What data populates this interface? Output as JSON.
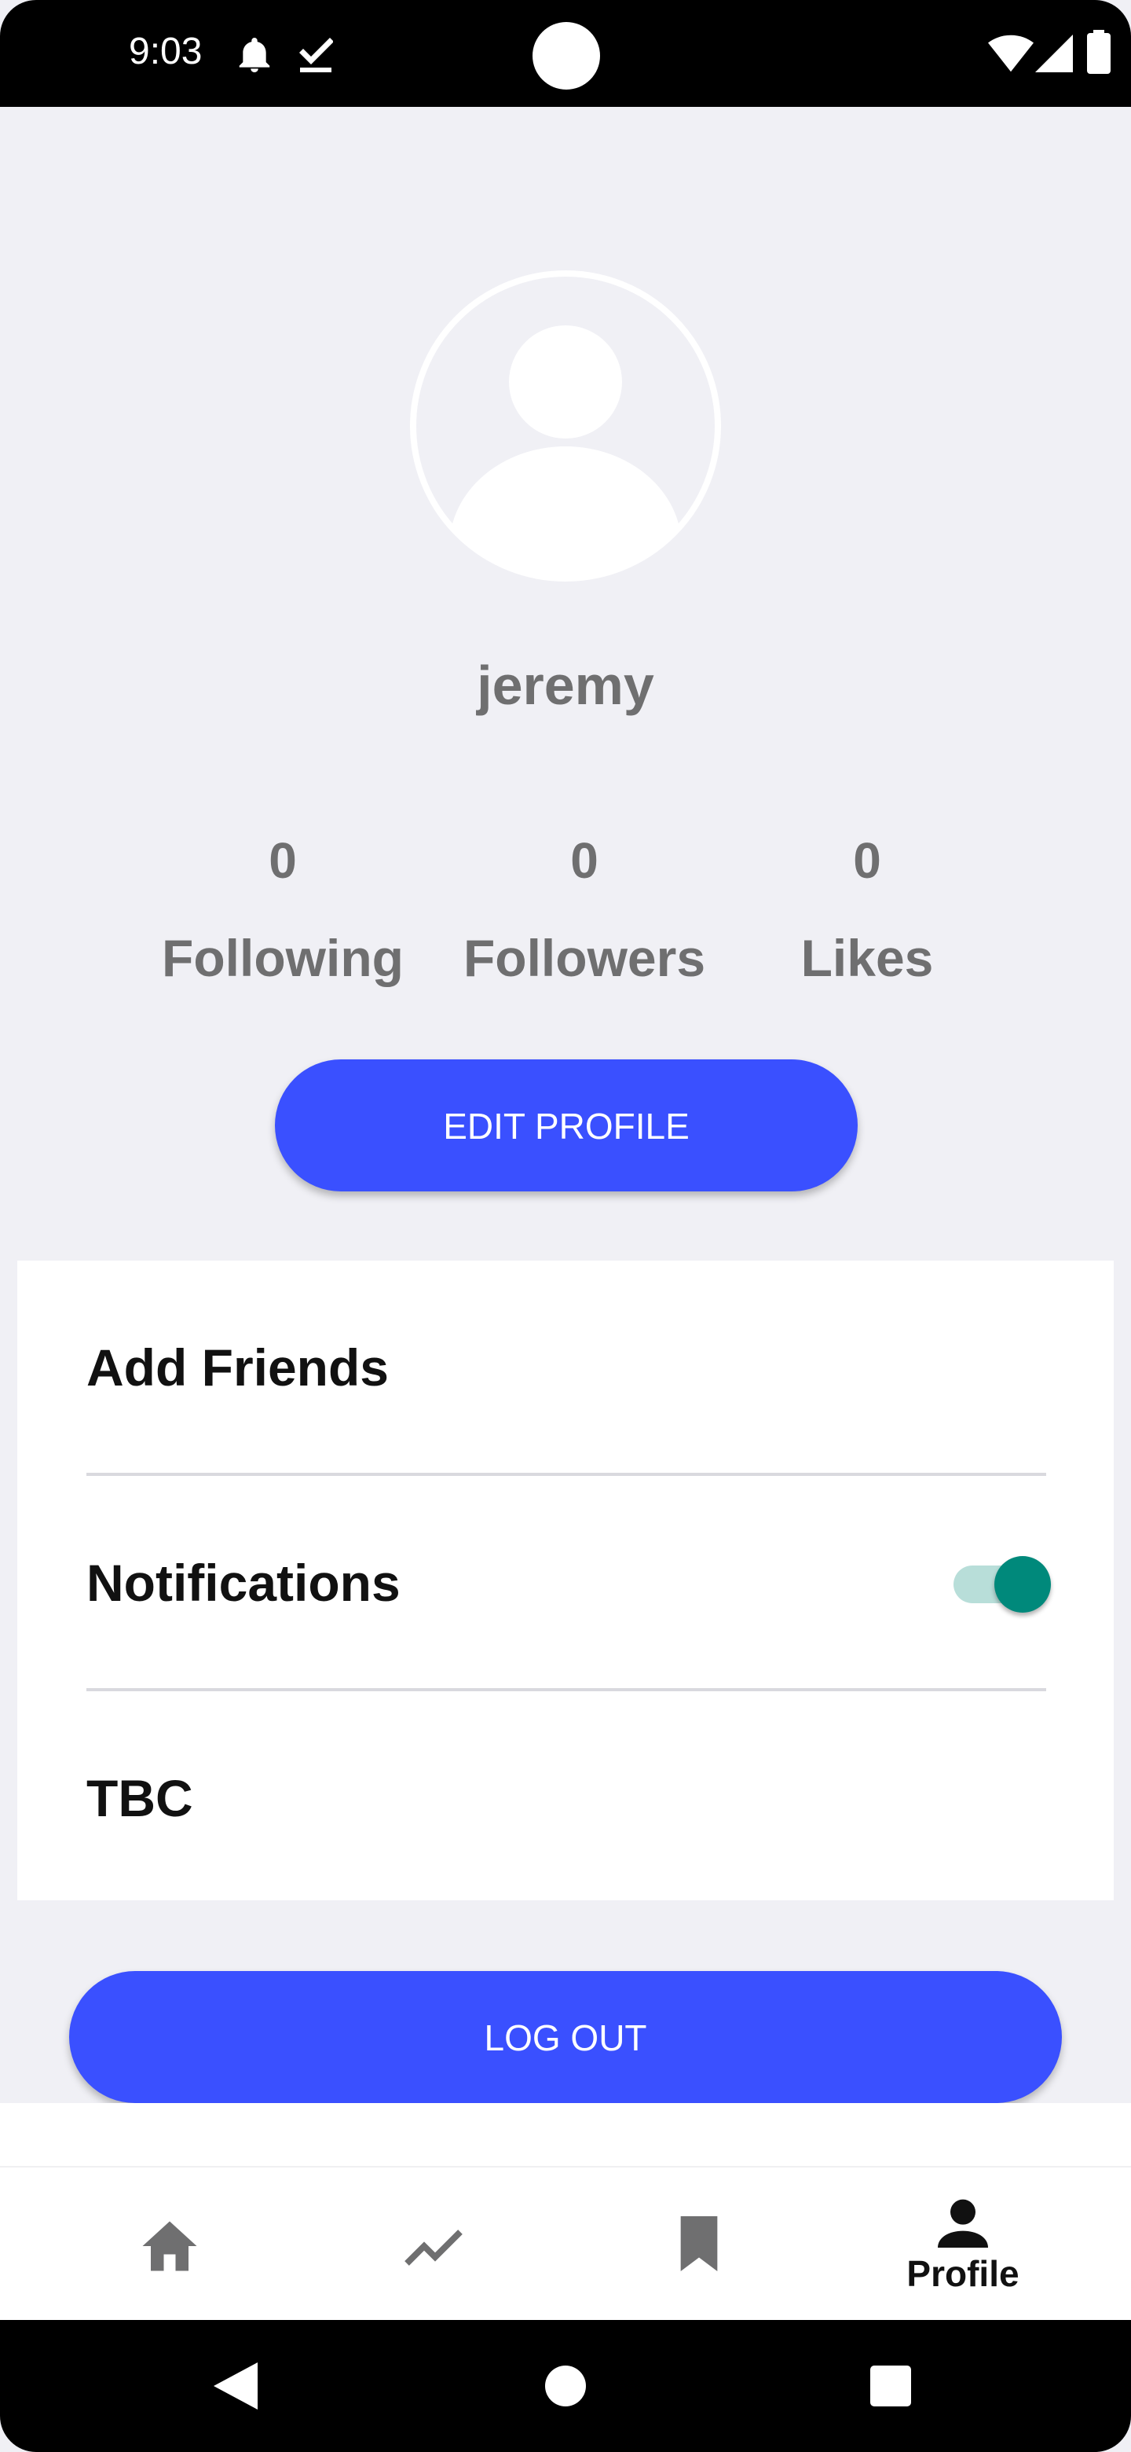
{
  "status_bar": {
    "time": "9:03",
    "icons": [
      "bell-icon",
      "check-download-icon",
      "wifi-icon",
      "signal-icon",
      "battery-icon"
    ]
  },
  "profile": {
    "username": "jeremy",
    "avatar_icon": "person-icon",
    "stats": [
      {
        "value": "0",
        "label": "Following"
      },
      {
        "value": "0",
        "label": "Followers"
      },
      {
        "value": "0",
        "label": "Likes"
      }
    ],
    "edit_button": "EDIT PROFILE"
  },
  "settings": {
    "items": [
      {
        "label": "Add Friends"
      },
      {
        "label": "Notifications",
        "toggle_on": true
      },
      {
        "label": "TBC"
      }
    ]
  },
  "logout_button": "LOG OUT",
  "bottom_nav": {
    "items": [
      {
        "icon": "home-icon",
        "label": ""
      },
      {
        "icon": "trending-icon",
        "label": ""
      },
      {
        "icon": "bookmark-icon",
        "label": ""
      },
      {
        "icon": "person-icon",
        "label": "Profile",
        "active": true
      }
    ]
  },
  "system_nav": {
    "icons": [
      "back-icon",
      "home-circle-icon",
      "recents-icon"
    ]
  },
  "colors": {
    "accent": "#3a50ff",
    "toggle_thumb": "#00897b",
    "toggle_track": "#b8ded9",
    "background": "#f0f0f5",
    "muted_text": "#6f6f70"
  }
}
